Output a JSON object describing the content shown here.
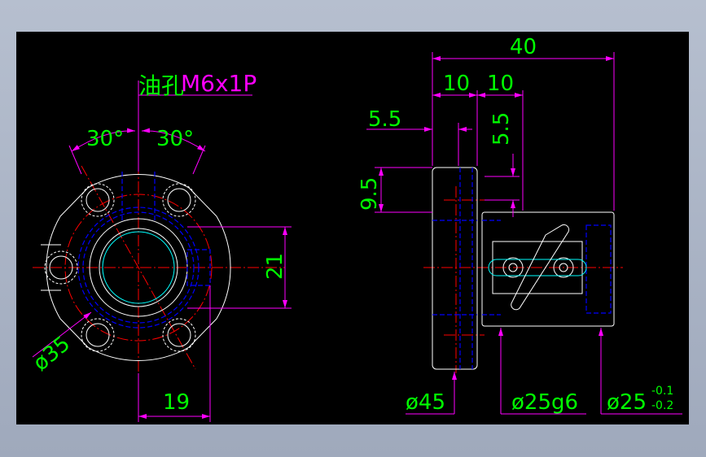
{
  "colors": {
    "background": "#000000",
    "geometry": "#ffffff",
    "dimension_lines": "#ff00ff",
    "dimension_text": "#00ff00",
    "center_lines": "#ff0000",
    "hidden_lines": "#0000ff",
    "bearing_outline": "#00ffff"
  },
  "front_view": {
    "note_label": "油孔",
    "note_thread": "M6x1P",
    "angle_left": "30°",
    "angle_right": "30°",
    "dim_diameter": "ø35",
    "dim_height": "21",
    "dim_width": "19"
  },
  "side_view": {
    "dim_overall": "40",
    "dim_flange": "10",
    "dim_body": "10",
    "dim_offset_left": "5.5",
    "dim_offset_vertical": "5.5",
    "dim_height": "9.5",
    "dim_flange_diameter": "ø45",
    "dim_shaft_diameter": "ø25g6",
    "dim_bore_diameter": "ø25",
    "tol_upper": "-0.1",
    "tol_lower": "-0.2"
  }
}
